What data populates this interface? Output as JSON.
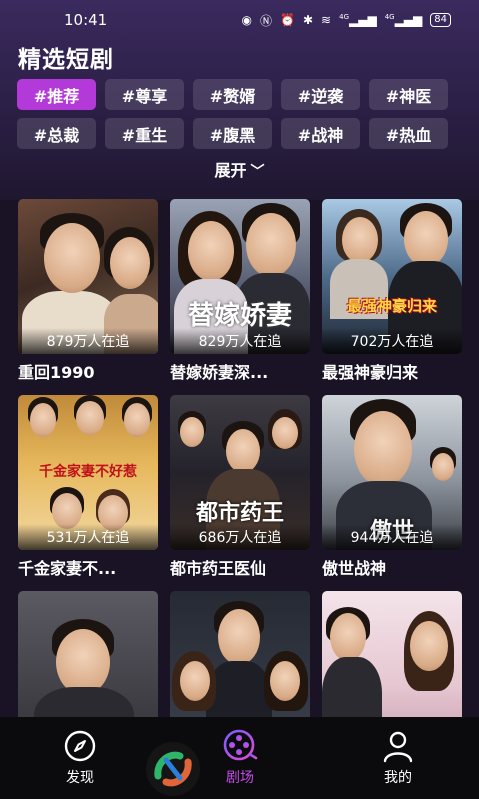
{
  "status_bar": {
    "time": "10:41",
    "network_1": "4G",
    "network_2": "4G",
    "battery": "84"
  },
  "page": {
    "title": "精选短剧",
    "expand_label": "展开"
  },
  "tags": [
    {
      "label": "#推荐",
      "active": true
    },
    {
      "label": "#尊享",
      "active": false
    },
    {
      "label": "#赘婿",
      "active": false
    },
    {
      "label": "#逆袭",
      "active": false
    },
    {
      "label": "#神医",
      "active": false
    },
    {
      "label": "#总裁",
      "active": false
    },
    {
      "label": "#重生",
      "active": false
    },
    {
      "label": "#腹黑",
      "active": false
    },
    {
      "label": "#战神",
      "active": false
    },
    {
      "label": "#热血",
      "active": false
    }
  ],
  "dramas": [
    {
      "title": "重回1990",
      "viewers": "879万人在追"
    },
    {
      "title": "替嫁娇妻深...",
      "viewers": "829万人在追",
      "poster_text": "替嫁娇妻"
    },
    {
      "title": "最强神豪归来",
      "viewers": "702万人在追",
      "poster_text": "最强神豪归来"
    },
    {
      "title": "千金家妻不...",
      "viewers": "531万人在追",
      "poster_text": "千金家妻不好惹"
    },
    {
      "title": "都市药王医仙",
      "viewers": "686万人在追",
      "poster_text": "都市药王"
    },
    {
      "title": "傲世战神",
      "viewers": "944万人在追",
      "poster_text": "傲世"
    },
    {
      "title": "",
      "viewers": ""
    },
    {
      "title": "",
      "viewers": ""
    },
    {
      "title": "",
      "viewers": ""
    }
  ],
  "bottom_nav": {
    "discover": "发现",
    "theater": "剧场",
    "mine": "我的"
  },
  "colors": {
    "accent": "#b33ad8",
    "nav_active": "#c64be6",
    "background": "#1a1326"
  }
}
